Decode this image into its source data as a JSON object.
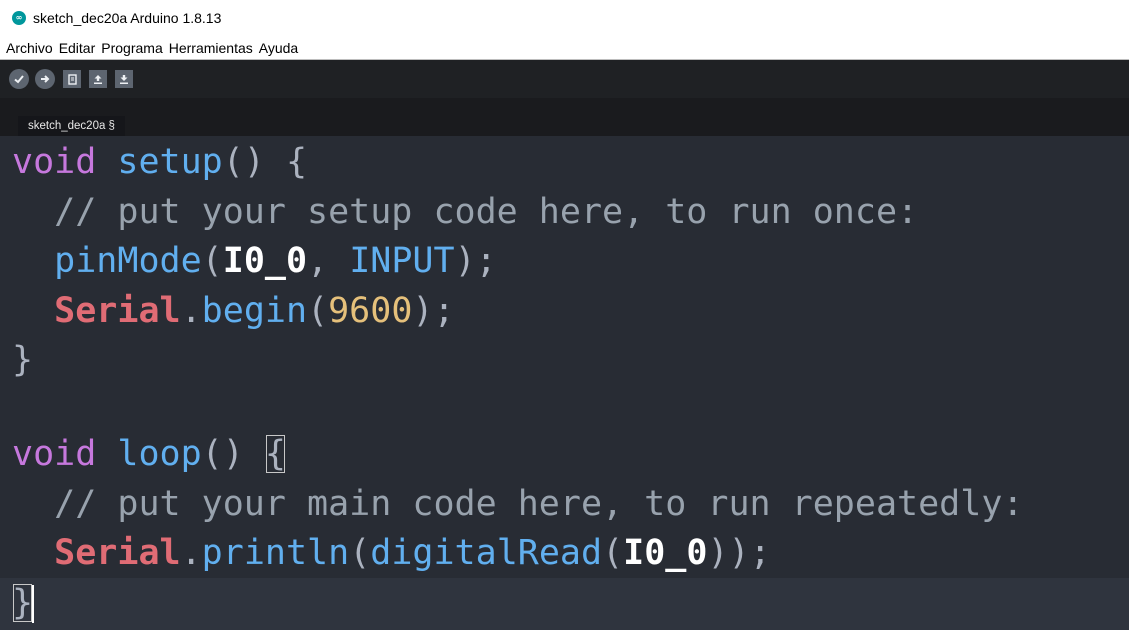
{
  "window": {
    "title": "sketch_dec20a Arduino 1.8.13",
    "logo_text": "∞"
  },
  "menu": [
    "Archivo",
    "Editar",
    "Programa",
    "Herramientas",
    "Ayuda"
  ],
  "toolbar": {
    "buttons": [
      "verify-icon",
      "upload-icon",
      "new-icon",
      "open-icon",
      "save-icon"
    ]
  },
  "tab": {
    "label": "sketch_dec20a §"
  },
  "code": {
    "l1_kw": "void",
    "l1_fn": "setup",
    "l1_rest": "() {",
    "l2_comment": "// put your setup code here, to run once:",
    "l3_fn": "pinMode",
    "l3_open": "(",
    "l3_const1": "I0_0",
    "l3_sep": ", ",
    "l3_const2": "INPUT",
    "l3_close": ");",
    "l4_class": "Serial",
    "l4_dot": ".",
    "l4_fn": "begin",
    "l4_open": "(",
    "l4_num": "9600",
    "l4_close": ");",
    "l5": "}",
    "l7_kw": "void",
    "l7_fn": "loop",
    "l7_rest": "() ",
    "l7_brace": "{",
    "l8_comment": "// put your main code here, to run repeatedly:",
    "l9_class": "Serial",
    "l9_dot": ".",
    "l9_fn1": "println",
    "l9_open1": "(",
    "l9_fn2": "digitalRead",
    "l9_open2": "(",
    "l9_const": "I0_0",
    "l9_close": "));",
    "l10": "}"
  },
  "colors": {
    "editor_bg": "#282c34",
    "keyword": "#c678dd",
    "function": "#61afef",
    "comment": "#98a2ad",
    "class": "#e06c75",
    "number": "#e5c07b"
  }
}
